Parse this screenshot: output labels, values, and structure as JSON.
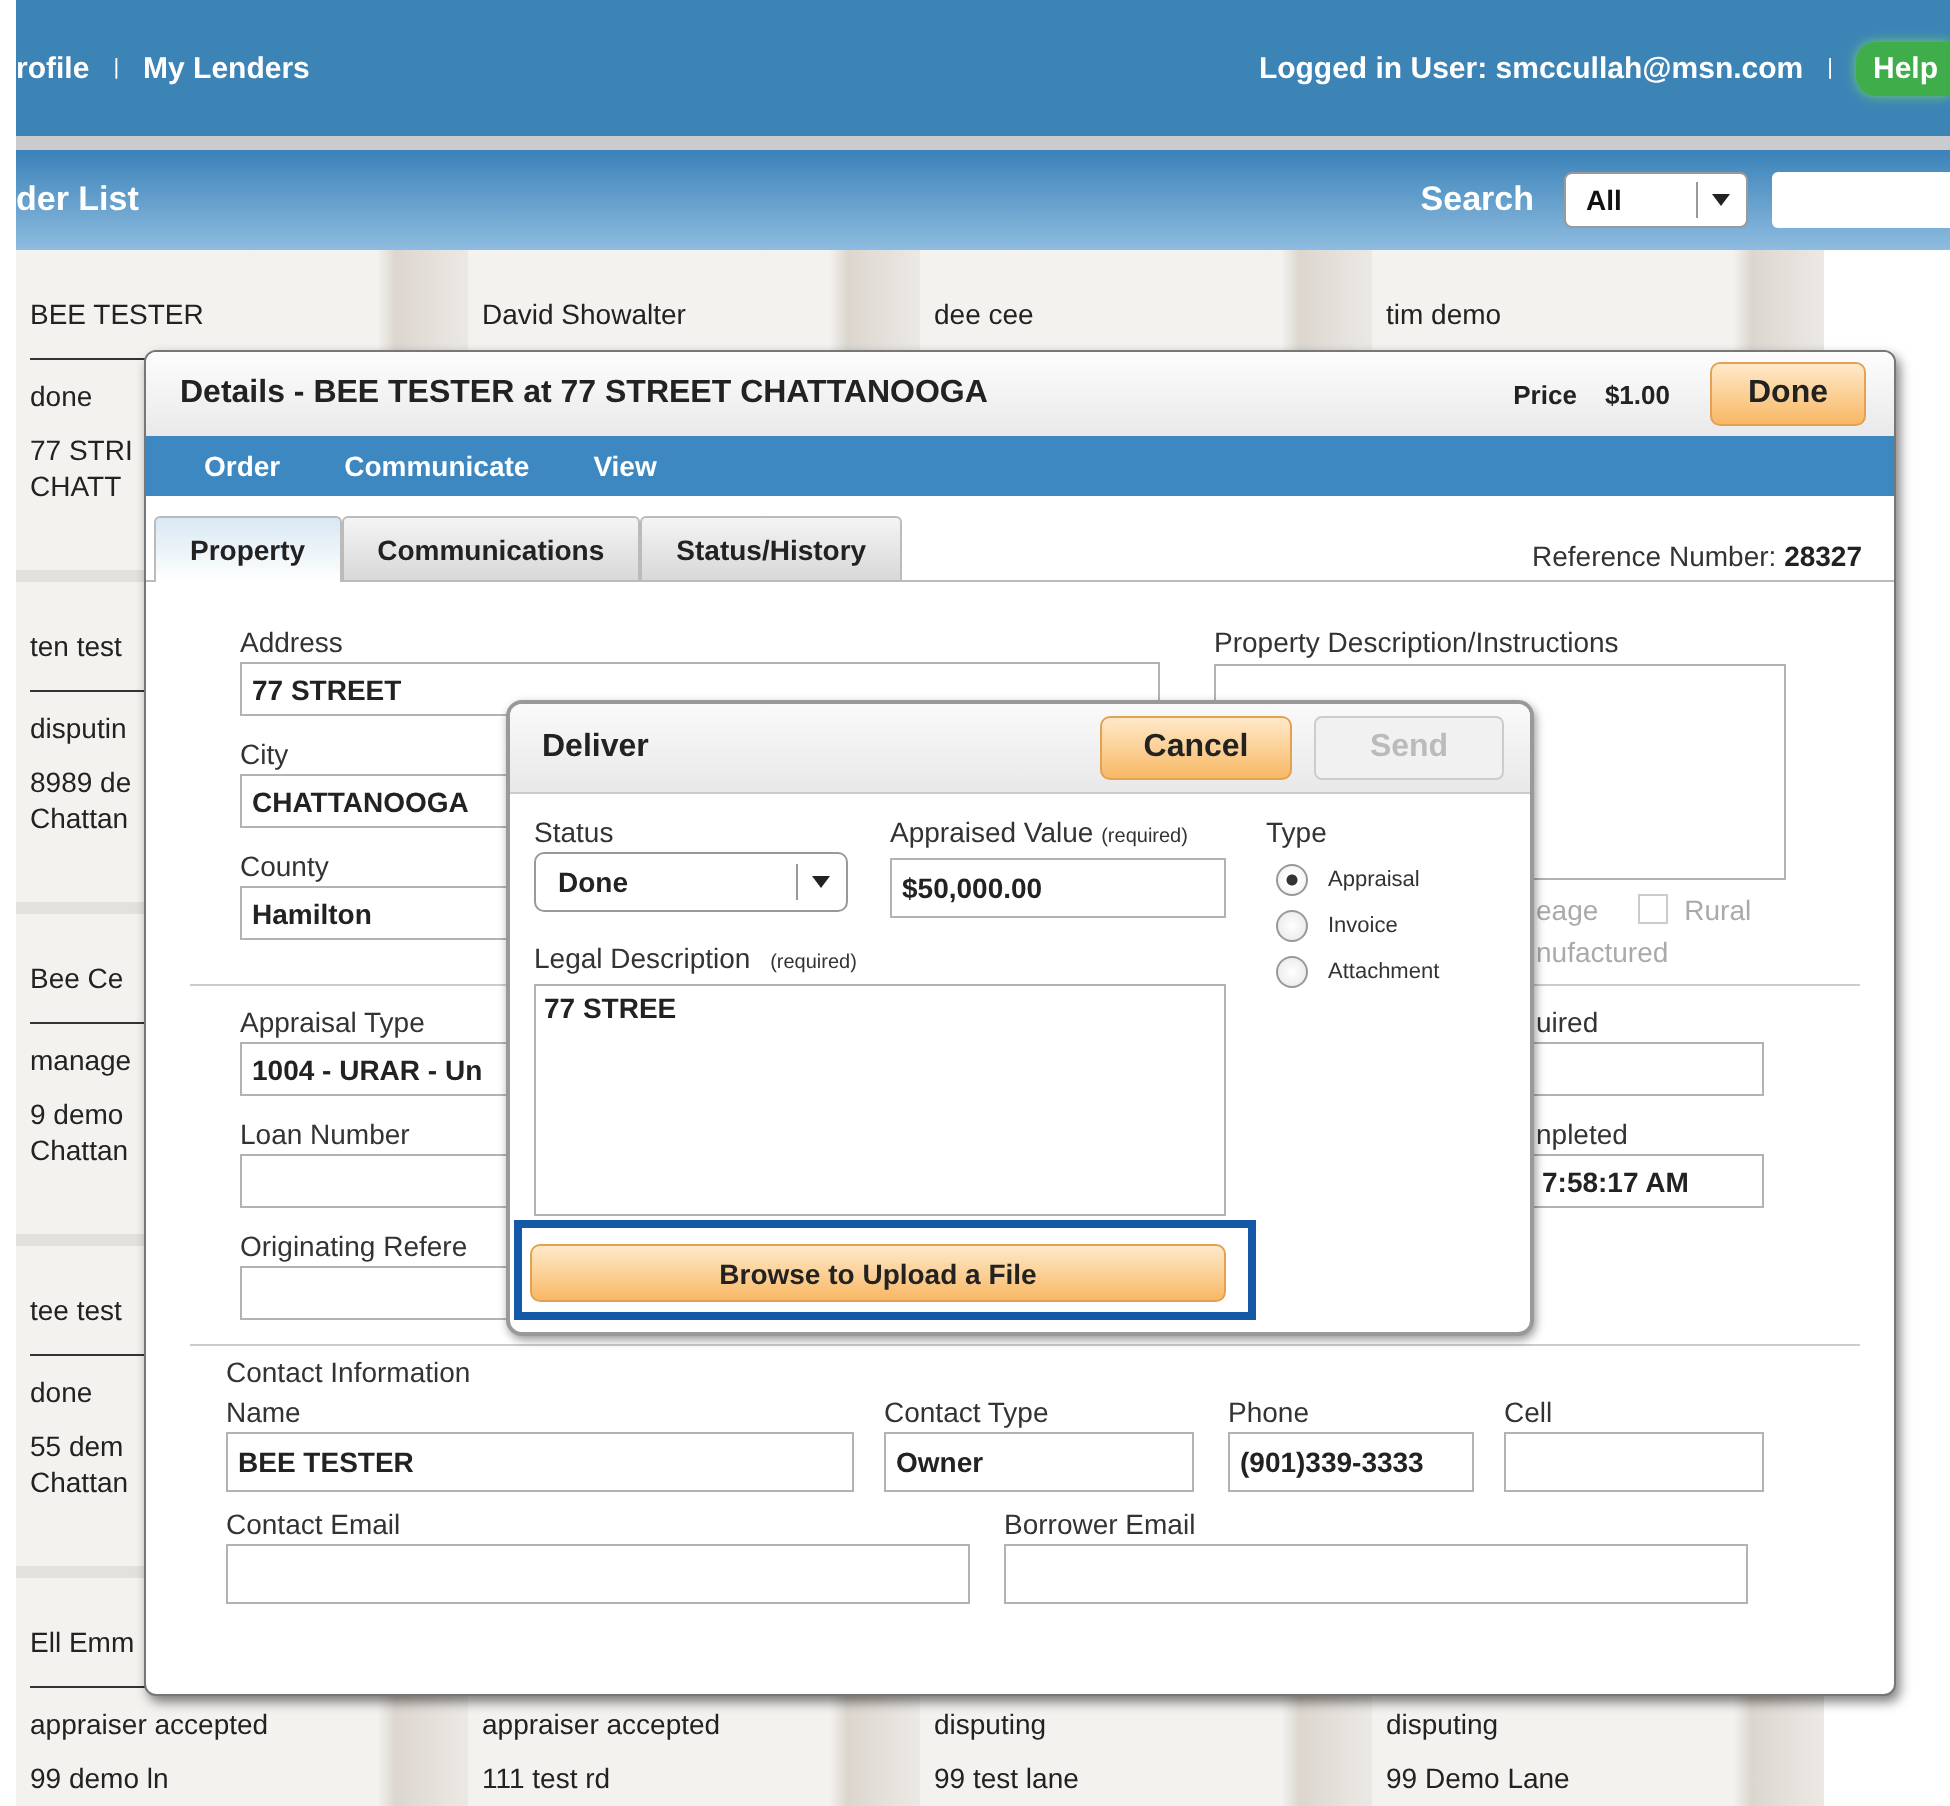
{
  "top_bar": {
    "left": [
      {
        "kind": "link",
        "text": "rofile"
      },
      {
        "kind": "separator",
        "text": "|"
      },
      {
        "kind": "link",
        "text": "My Lenders"
      }
    ],
    "right": [
      {
        "kind": "text",
        "text": "Logged in User: smccullah@msn.com"
      },
      {
        "kind": "separator",
        "text": "|"
      },
      {
        "kind": "help",
        "text": "Help"
      }
    ]
  },
  "list_bar": {
    "title": "der List",
    "search_label": "Search",
    "search_scope": "All"
  },
  "order_columns": [
    {
      "cards": [
        {
          "name": "BEE TESTER",
          "lines": [
            "done",
            "77 STRI",
            "CHATT"
          ]
        },
        {
          "name": "ten test",
          "lines": [
            "disputin",
            "8989 de",
            "Chattan"
          ]
        },
        {
          "name": "Bee Ce",
          "lines": [
            "manage",
            "9 demo",
            "Chattan"
          ]
        },
        {
          "name": "tee test",
          "lines": [
            "done",
            "55 dem",
            "Chattan"
          ]
        },
        {
          "name": "Ell Emm",
          "lines": [
            "appraiser accepted",
            "99 demo ln"
          ]
        }
      ]
    },
    {
      "cards": [
        {
          "name": "David Showalter"
        },
        {
          "lines": [
            "appraiser accepted",
            "111 test rd"
          ]
        }
      ]
    },
    {
      "cards": [
        {
          "name": "dee cee"
        },
        {
          "lines": [
            "disputing",
            "99 test lane"
          ]
        }
      ]
    },
    {
      "cards": [
        {
          "name": "tim demo"
        },
        {
          "lines": [
            "disputing",
            "99 Demo Lane"
          ]
        }
      ]
    }
  ],
  "details": {
    "title": "Details - BEE TESTER at 77 STREET CHATTANOOGA",
    "price_label": "Price",
    "price": "$1.00",
    "done_button": "Done",
    "menu": [
      "Order",
      "Communicate",
      "View"
    ],
    "tabs": [
      {
        "label": "Property",
        "selected": true
      },
      {
        "label": "Communications",
        "selected": false
      },
      {
        "label": "Status/History",
        "selected": false
      }
    ],
    "reference_label": "Reference Number:",
    "reference": "28327",
    "address_fields": [
      {
        "label": "Address",
        "value": "77 STREET"
      },
      {
        "label": "City",
        "value": "CHATTANOOGA"
      },
      {
        "label": "County",
        "value": "Hamilton"
      }
    ],
    "description_label": "Property Description/Instructions",
    "options": [
      {
        "label": "eage"
      },
      {
        "label": "Rural",
        "checked": false
      },
      {
        "label": "nufactured"
      }
    ],
    "appraisal_fields": [
      {
        "label": "Appraisal Type",
        "value": "1004 - URAR - Un"
      },
      {
        "label": "Loan Number"
      },
      {
        "label": "Originating Refere"
      }
    ],
    "date_fields": [
      {
        "label": "uired"
      },
      {
        "label": "npleted",
        "value": "7:58:17 AM"
      }
    ],
    "contact_heading": "Contact Information",
    "contact_fields": [
      {
        "label": "Name",
        "value": "BEE TESTER"
      },
      {
        "label": "Contact Type",
        "value": "Owner"
      },
      {
        "label": "Phone",
        "value": "(901)339-3333"
      },
      {
        "label": "Cell"
      }
    ],
    "email_fields": [
      {
        "label": "Contact Email"
      },
      {
        "label": "Borrower Email"
      }
    ]
  },
  "deliver": {
    "title": "Deliver",
    "cancel_button": "Cancel",
    "send_button": {
      "label": "Send",
      "disabled": true
    },
    "status_label": "Status",
    "status": "Done",
    "value_label": "Appraised Value",
    "value_note": "(required)",
    "value": "$50,000.00",
    "type_label": "Type",
    "types": [
      {
        "label": "Appraisal",
        "selected": true
      },
      {
        "label": "Invoice",
        "selected": false
      },
      {
        "label": "Attachment",
        "selected": false
      }
    ],
    "legal_label": "Legal Description",
    "legal_note": "(required)",
    "legal": "77 STREE",
    "browse_button": "Browse to Upload a File",
    "browse_highlighted": true
  }
}
